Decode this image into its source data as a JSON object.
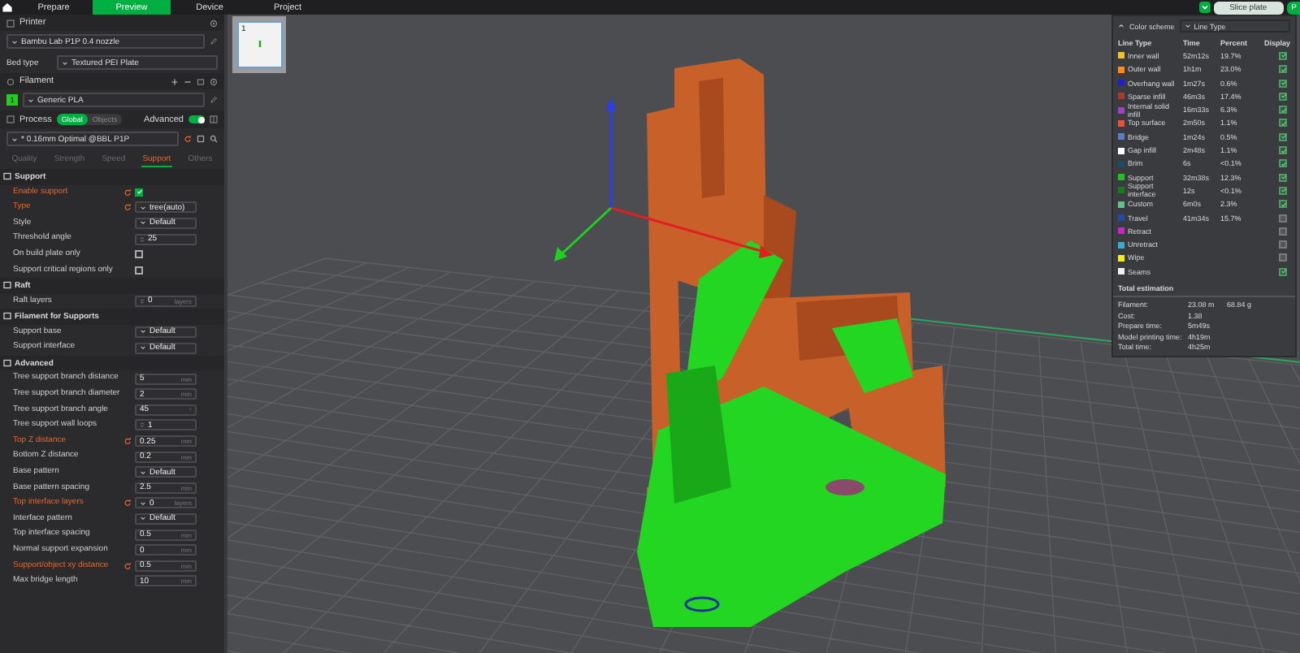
{
  "topbar": {
    "tabs": [
      {
        "label": "Prepare",
        "selected": false
      },
      {
        "label": "Preview",
        "selected": true
      },
      {
        "label": "Device",
        "selected": false
      },
      {
        "label": "Project",
        "selected": false
      }
    ],
    "slice_button": "Slice plate",
    "print_button": "P"
  },
  "printer": {
    "title": "Printer",
    "preset": "Bambu Lab P1P 0.4 nozzle",
    "bed_label": "Bed type",
    "bed_value": "Textured PEI Plate"
  },
  "filament": {
    "title": "Filament",
    "slots": [
      {
        "number": "1",
        "color": "#22cc22",
        "name": "Generic PLA"
      }
    ]
  },
  "process": {
    "title": "Process",
    "modes": [
      {
        "label": "Global",
        "selected": true
      },
      {
        "label": "Objects",
        "selected": false
      }
    ],
    "advanced": {
      "label": "Advanced",
      "on": true
    },
    "preset": "* 0.16mm Optimal @BBL P1P",
    "tabs": [
      {
        "label": "Quality",
        "selected": false
      },
      {
        "label": "Strength",
        "selected": false
      },
      {
        "label": "Speed",
        "selected": false
      },
      {
        "label": "Support",
        "selected": true
      },
      {
        "label": "Others",
        "selected": false
      }
    ]
  },
  "sections": [
    {
      "title": "Support",
      "params": [
        {
          "label": "Enable support",
          "kind": "checkbox",
          "checked": true,
          "modified": true
        },
        {
          "label": "Type",
          "kind": "select",
          "value": "tree(auto)",
          "modified": true
        },
        {
          "label": "Style",
          "kind": "select",
          "value": "Default",
          "modified": false
        },
        {
          "label": "Threshold angle",
          "kind": "spin",
          "value": "25",
          "modified": false
        },
        {
          "label": "On build plate only",
          "kind": "checkbox",
          "checked": false,
          "modified": false
        },
        {
          "label": "Support critical regions only",
          "kind": "checkbox",
          "checked": false,
          "modified": false
        }
      ]
    },
    {
      "title": "Raft",
      "params": [
        {
          "label": "Raft layers",
          "kind": "spin",
          "value": "0",
          "unit": "layers",
          "modified": false
        }
      ]
    },
    {
      "title": "Filament for Supports",
      "params": [
        {
          "label": "Support base",
          "kind": "select",
          "value": "Default",
          "modified": false
        },
        {
          "label": "Support interface",
          "kind": "select",
          "value": "Default",
          "modified": false
        }
      ]
    },
    {
      "title": "Advanced",
      "params": [
        {
          "label": "Tree support branch distance",
          "kind": "number",
          "value": "5",
          "unit": "mm",
          "modified": false
        },
        {
          "label": "Tree support branch diameter",
          "kind": "number",
          "value": "2",
          "unit": "mm",
          "modified": false
        },
        {
          "label": "Tree support branch angle",
          "kind": "number",
          "value": "45",
          "unit": "°",
          "modified": false
        },
        {
          "label": "Tree support wall loops",
          "kind": "spin",
          "value": "1",
          "modified": false
        },
        {
          "label": "Top Z distance",
          "kind": "number",
          "value": "0.25",
          "unit": "mm",
          "modified": true
        },
        {
          "label": "Bottom Z distance",
          "kind": "number",
          "value": "0.2",
          "unit": "mm",
          "modified": false
        },
        {
          "label": "Base pattern",
          "kind": "select",
          "value": "Default",
          "modified": false
        },
        {
          "label": "Base pattern spacing",
          "kind": "number",
          "value": "2.5",
          "unit": "mm",
          "modified": false
        },
        {
          "label": "Top interface layers",
          "kind": "select",
          "value": "0",
          "unit": "layers",
          "modified": true
        },
        {
          "label": "Interface pattern",
          "kind": "select",
          "value": "Default",
          "modified": false
        },
        {
          "label": "Top interface spacing",
          "kind": "number",
          "value": "0.5",
          "unit": "mm",
          "modified": false
        },
        {
          "label": "Normal support expansion",
          "kind": "number",
          "value": "0",
          "unit": "mm",
          "modified": false
        },
        {
          "label": "Support/object xy distance",
          "kind": "number",
          "value": "0.5",
          "unit": "mm",
          "modified": true
        },
        {
          "label": "Max bridge length",
          "kind": "number",
          "value": "10",
          "unit": "mm",
          "modified": false
        }
      ]
    }
  ],
  "plates": [
    {
      "number": "1"
    }
  ],
  "legend": {
    "scheme_label": "Color scheme",
    "scheme_value": "Line Type",
    "columns": [
      "Line Type",
      "Time",
      "Percent",
      "Display"
    ],
    "items": [
      {
        "name": "Inner wall",
        "color": "#f2c12e",
        "time": "52m12s",
        "percent": "19.7%",
        "display": true
      },
      {
        "name": "Outer wall",
        "color": "#ff8c1a",
        "time": "1h1m",
        "percent": "23.0%",
        "display": true
      },
      {
        "name": "Overhang wall",
        "color": "#2020d0",
        "time": "1m27s",
        "percent": "0.6%",
        "display": true
      },
      {
        "name": "Sparse infill",
        "color": "#a83a2c",
        "time": "46m3s",
        "percent": "17.4%",
        "display": true
      },
      {
        "name": "Internal solid infill",
        "color": "#a040c8",
        "time": "16m33s",
        "percent": "6.3%",
        "display": true
      },
      {
        "name": "Top surface",
        "color": "#e0553c",
        "time": "2m50s",
        "percent": "1.1%",
        "display": true
      },
      {
        "name": "Bridge",
        "color": "#5a80c0",
        "time": "1m24s",
        "percent": "0.5%",
        "display": true
      },
      {
        "name": "Gap infill",
        "color": "#ffffff",
        "time": "2m48s",
        "percent": "1.1%",
        "display": true
      },
      {
        "name": "Brim",
        "color": "#1e4a66",
        "time": "6s",
        "percent": "<0.1%",
        "display": true
      },
      {
        "name": "Support",
        "color": "#22c022",
        "time": "32m38s",
        "percent": "12.3%",
        "display": true
      },
      {
        "name": "Support interface",
        "color": "#1a7a1a",
        "time": "12s",
        "percent": "<0.1%",
        "display": true
      },
      {
        "name": "Custom",
        "color": "#5ec38c",
        "time": "6m0s",
        "percent": "2.3%",
        "display": true
      },
      {
        "name": "Travel",
        "color": "#2848a8",
        "time": "41m34s",
        "percent": "15.7%",
        "display": false
      },
      {
        "name": "Retract",
        "color": "#cc22cc",
        "display": false
      },
      {
        "name": "Unretract",
        "color": "#40a8c8",
        "display": false
      },
      {
        "name": "Wipe",
        "color": "#f0f020",
        "display": false
      },
      {
        "name": "Seams",
        "color": "#f0f0f0",
        "display": true
      }
    ],
    "totals_title": "Total estimation",
    "totals": [
      {
        "label": "Filament:",
        "values": [
          "23.08 m",
          "68.84 g"
        ]
      },
      {
        "label": "Cost:",
        "values": [
          "1.38"
        ]
      },
      {
        "label": "Prepare time:",
        "values": [
          "5m49s"
        ]
      },
      {
        "label": "Model printing time:",
        "values": [
          "4h19m"
        ]
      },
      {
        "label": "Total time:",
        "values": [
          "4h25m"
        ]
      }
    ]
  }
}
